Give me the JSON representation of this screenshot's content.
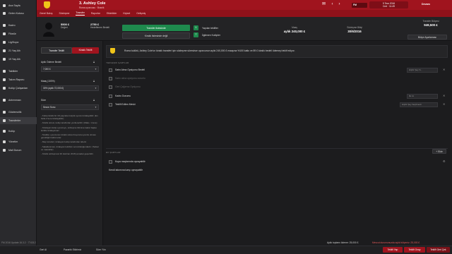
{
  "sidebar": {
    "items": [
      {
        "label": "Ana Sayfa",
        "icon": "home-icon"
      },
      {
        "label": "Gelen Kutusu",
        "icon": "inbox-icon"
      },
      {
        "label": "Kadro",
        "icon": "squad-icon"
      },
      {
        "label": "Fikstür",
        "icon": "calendar-icon"
      },
      {
        "label": "Lig/Kupa",
        "icon": "trophy-icon"
      },
      {
        "label": "21 Yaş Altı",
        "icon": "youth-icon"
      },
      {
        "label": "19 Yaş Altı",
        "icon": "youth-icon"
      },
      {
        "label": "Taktikler",
        "icon": "tactics-icon"
      },
      {
        "label": "Takım Raporu",
        "icon": "report-icon"
      },
      {
        "label": "Kulüp Çalışanları",
        "icon": "staff-icon"
      },
      {
        "label": "Antrenman",
        "icon": "training-icon"
      },
      {
        "label": "Gözlemcilik",
        "icon": "scouting-icon"
      },
      {
        "label": "Transferler",
        "icon": "transfers-icon"
      },
      {
        "label": "Kulüp",
        "icon": "club-icon"
      },
      {
        "label": "Yönetim",
        "icon": "board-icon"
      },
      {
        "label": "Mali Durum",
        "icon": "finance-icon"
      }
    ]
  },
  "header": {
    "title": "3. Ashley Cole",
    "subtitle": "Roma oyuncusu · Bosnik",
    "date_line1": "9 Tem 2016",
    "date_line2": "Cmt · 11:49",
    "fm_label": "FM",
    "continue_label": "Devam"
  },
  "subnav": {
    "tabs": [
      "Genel Bakış",
      "Sözleşme",
      "Transfer",
      "Raporlar",
      "Etkinlikler",
      "Kişisel",
      "Gelişmiş"
    ],
    "active_index": 2
  },
  "infostrip": {
    "value1": "5500 £",
    "value1_label": "Değeri",
    "value2": "2750 £",
    "value2_label": "Hedeflenen Bedeli",
    "btn_transfer_open": "Transfer listesinde",
    "btn_loan": "Kiralık listesinde değil",
    "offers_count": "1",
    "offers_label": "Yapılan teklifler",
    "interest_count": "7",
    "interest_label": "İlgilenen Kulüpler",
    "wage_label": "Maaş",
    "wage_value": "aylık 240,000 £",
    "contract_label": "Sözleşme Bitişi",
    "contract_value": "30/6/2016",
    "role_label": "Kulübe Rolü",
    "role_value": "Oyun",
    "budget_label": "Transfer Bütçesi",
    "budget_value": "949,500 £",
    "budget_sub": "Bütçe Ayarlaması"
  },
  "leftpanel": {
    "tab_active": "Transfer Teklifi",
    "tab_inactive": "Kiralık Teklifi",
    "fee_label": "Aylık Ödeme Bedeli",
    "fee_value": "7,000 £",
    "wage_label": "Maaş (100%)",
    "wage_value": "30% (aylık 72,000 £)",
    "duration_label": "Süre",
    "duration_value": "Sezon Sonu",
    "notes": [
      "- Kulüp kiralık bir 18 yaşından küçük oyuncu kiralayabilir. (En fazla 2 kere kiralayabilir)",
      "- Kiralık süresi, kulüp tarafından yenilenebilir. (Maks. 1 kere)",
      "- Kiralayan kulüp oyuncuyu, sözleşme bitimine kadar başka kulübe kiralayamaz.",
      "- Taraflar, oyuncunun kiralık süresi boyunca uyumlu olması gerektiğini kabul eder.",
      "- Maç ücretleri, kiralayan kulüp tarafından ödenir.",
      "- Sakatlanması, kiralayan kulübün sorumluluğundadır. (Tedavi ve masraflar)",
      "- Kiralık sözleşmesi 30 Haziran 2016'ya kadar geçerlidir."
    ]
  },
  "main": {
    "message": "Roma kulübü, Ashley Cole'un kiralık transferi için sözleşme süresince oyuncunun aylık 240,000 £ maaşına %100 katkı ve 89 £ kiralık bedeli ödemeyi teklif ediyor.",
    "clauses_title": "YERLEŞIK ŞARTLAR",
    "clauses": [
      {
        "label": "Satın Alma Opsiyonu Bedeli",
        "value": "Hiçbir Şey S...",
        "dim": false
      },
      {
        "label": "Satın alma opsiyonu zorunlu",
        "value": "",
        "dim": true
      },
      {
        "label": "Geri Çağırma Opsiyonu",
        "value": "",
        "dim": true
      },
      {
        "label": "Kadro Durumu",
        "value": "İlk 11",
        "dim": false
      },
      {
        "label": "Teklifi Edilen Mevki",
        "value": "Hiçbir Şey Seçilmedi",
        "dim": false
      }
    ],
    "extra_title": "EK ŞARTLAR",
    "add_clause_label": "+ Ekle",
    "extra_items": [
      {
        "label": "Kupa maçlarında oynayabilir"
      },
      {
        "label": "Kendi takımına karşı oynayabilir"
      }
    ]
  },
  "footer": {
    "back_label": "Geri Al",
    "edit_label": "Pazarlık Ekibimiz",
    "tools_label": "Süre Yön",
    "monthly_total": "Aylık toplamı ödeme: 25,000 £",
    "warning": "Mevcut durumunuzda aylık bütçeniz: 25,000 £",
    "btn_offer": "Teklifi Yap",
    "btn_decline": "Teklifi Onay",
    "btn_cancel": "Teklifi Reddet",
    "btn_back": "Teklifi Geri Çek",
    "build_info": "FM 2016 Update 16.3.2 · 774312"
  },
  "colors": {
    "brand_red": "#a0141e",
    "accent_green": "#1e8a4d",
    "sidebar_bg": "#2a2a2d"
  }
}
